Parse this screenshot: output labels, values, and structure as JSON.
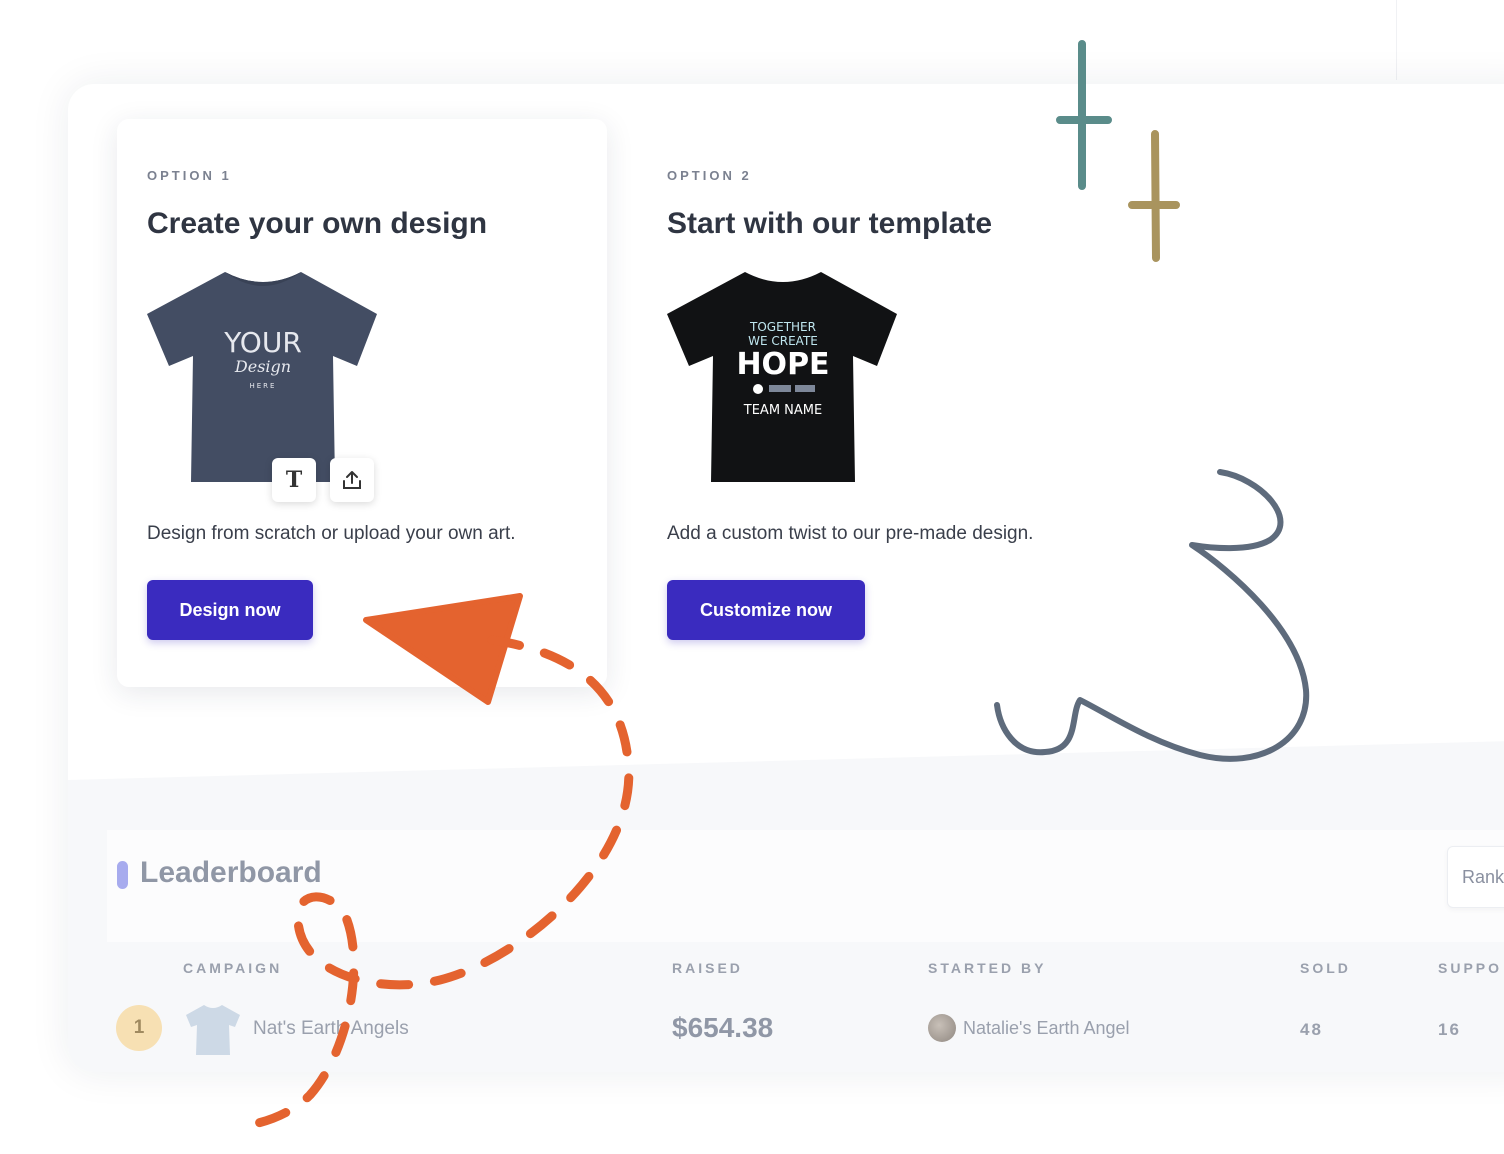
{
  "option1": {
    "label": "OPTION 1",
    "title": "Create your own design",
    "shirt_text_line1": "YOUR",
    "shirt_text_line2": "Design",
    "shirt_text_line3": "HERE",
    "text_tool_label": "T",
    "upload_icon": "upload-icon",
    "description": "Design from scratch or upload your own art.",
    "button_label": "Design now"
  },
  "option2": {
    "label": "OPTION 2",
    "title": "Start with our template",
    "shirt_text_line1": "TOGETHER",
    "shirt_text_line2": "WE CREATE",
    "shirt_text_line3": "HOPE",
    "shirt_text_line4": "TEAM NAME",
    "description": "Add a custom twist to our pre-made design.",
    "button_label": "Customize now"
  },
  "leaderboard": {
    "title": "Leaderboard",
    "rank_select": "Rank",
    "columns": [
      "CAMPAIGN",
      "RAISED",
      "STARTED BY",
      "SOLD",
      "SUPPO"
    ],
    "rows": [
      {
        "rank": "1",
        "campaign": "Nat's Earth Angels",
        "raised": "$654.38",
        "started_by": "Natalie's Earth Angel",
        "sold": "48",
        "supporters": "16"
      }
    ]
  },
  "colors": {
    "primary_button": "#3a2bbf",
    "annotation_orange": "#e4632f",
    "annotation_slate": "#5e6b7c",
    "plus_teal": "#5a8c8a",
    "plus_gold": "#a9945e",
    "leaderboard_accent": "#a7abee"
  }
}
